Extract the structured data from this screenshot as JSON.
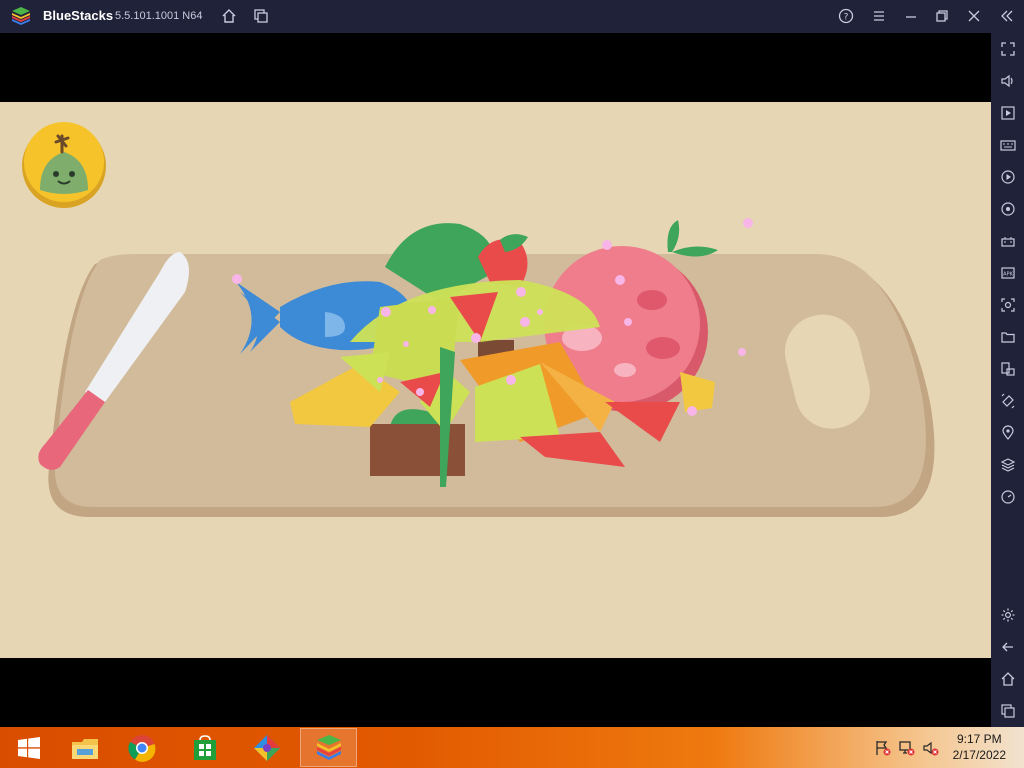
{
  "window": {
    "app_name": "BlueStacks",
    "version": "5.5.101.1001 N64"
  },
  "titlebar_icons": [
    "home-icon",
    "multi-instance-icon",
    "help-icon",
    "menu-icon",
    "minimize-icon",
    "restore-icon",
    "close-icon",
    "collapse-sidebar-icon"
  ],
  "sidebar_icons": [
    "fullscreen-icon",
    "volume-icon",
    "media-manager-icon",
    "keyboard-controls-icon",
    "macro-recorder-icon",
    "sync-icon",
    "gamepad-icon",
    "install-apk-icon",
    "screenshot-icon",
    "folder-icon",
    "rotate-icon",
    "shake-icon",
    "location-icon",
    "layers-icon",
    "eco-mode-icon",
    "settings-icon",
    "back-icon",
    "android-home-icon",
    "recent-apps-icon"
  ],
  "taskbar": {
    "apps": [
      "start-icon",
      "file-explorer-icon",
      "chrome-icon",
      "store-icon",
      "game-icon",
      "bluestacks-icon"
    ],
    "time": "9:17 PM",
    "date": "2/17/2022"
  },
  "colors": {
    "titlebar_bg": "#1f2238",
    "game_bg": "#e6d6b4",
    "board": "#cfb796",
    "knife_handle": "#e8677a",
    "fish": "#3d8ad6"
  }
}
